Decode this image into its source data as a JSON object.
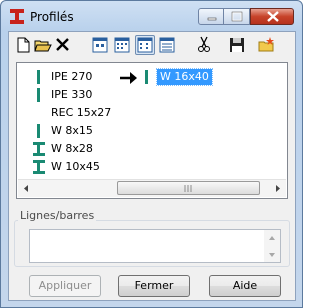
{
  "window": {
    "title": "Profilés",
    "icon": "red-i-beam-icon",
    "controls": [
      "minimize-icon",
      "maximize-icon",
      "close-icon"
    ]
  },
  "toolbar": {
    "tools": [
      {
        "name": "new-file-icon"
      },
      {
        "name": "open-folder-icon"
      },
      {
        "name": "delete-x-icon"
      },
      {
        "name": "view-large-icons-icon"
      },
      {
        "name": "view-small-icons-icon"
      },
      {
        "name": "view-list-icon",
        "active": true
      },
      {
        "name": "view-details-icon"
      },
      {
        "name": "scissors-icon"
      },
      {
        "name": "save-disk-icon"
      },
      {
        "name": "folder-star-icon"
      }
    ]
  },
  "profiles": {
    "items": [
      "IPE 270",
      "IPE 330",
      "REC 15x27",
      "W 8x15",
      "W 8x28",
      "W 10x45"
    ],
    "selected": "W 16x40"
  },
  "lines_group": {
    "label": "Lignes/barres",
    "value": ""
  },
  "buttons": {
    "apply": "Appliquer",
    "close": "Fermer",
    "help": "Aide"
  },
  "colors": {
    "ibeam_green": "#1a8a73",
    "selection": "#3399ff",
    "brand_red": "#c8221b"
  }
}
